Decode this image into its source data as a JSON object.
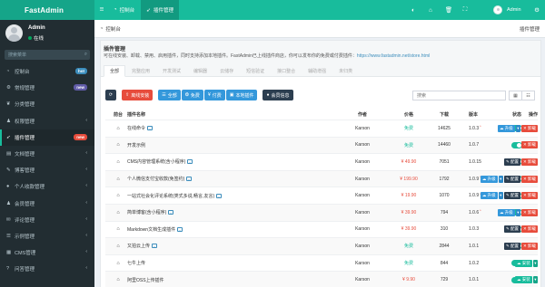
{
  "brand": "FastAdmin",
  "topnav": {
    "console": "控制台",
    "plugins": "插件管理"
  },
  "user": {
    "name": "Admin",
    "status": "在线"
  },
  "sidebar": {
    "search_placeholder": "搜索菜单",
    "items": [
      {
        "label": "控制台",
        "icon": "dashboard-icon",
        "badge": "hot",
        "badge_color": "#3c8dbc"
      },
      {
        "label": "常规管理",
        "icon": "cogs-icon",
        "badge": "new",
        "badge_color": "#605ca8"
      },
      {
        "label": "分类管理",
        "icon": "leaf-icon"
      },
      {
        "label": "权限管理",
        "icon": "group-icon"
      },
      {
        "label": "插件管理",
        "icon": "rocket-icon",
        "badge": "new",
        "badge_color": "#e74c3c",
        "active": true
      },
      {
        "label": "文档管理",
        "icon": "file-icon"
      },
      {
        "label": "博客管理",
        "icon": "blog-icon"
      },
      {
        "label": "个人收款管理",
        "icon": "user-icon"
      },
      {
        "label": "会员管理",
        "icon": "users-icon"
      },
      {
        "label": "评论管理",
        "icon": "comment-icon"
      },
      {
        "label": "示例管理",
        "icon": "list-icon"
      },
      {
        "label": "CMS管理",
        "icon": "cms-icon"
      },
      {
        "label": "问答管理",
        "icon": "question-icon"
      }
    ]
  },
  "breadcrumb": {
    "left": "控制台",
    "right": "插件管理"
  },
  "panel": {
    "title": "插件管理",
    "desc": "可在线安装、卸载、禁用、启用插件，同时支持添加本地插件。FastAdmin已上线插件商店，你可以发布你的免费或付费插件：",
    "link": "https://www.fastadmin.net/store.html"
  },
  "tabs": [
    "全部",
    "完整应用",
    "开发测试",
    "编辑器",
    "云储存",
    "短信验证",
    "接口整合",
    "辅助增强",
    "未归类"
  ],
  "toolbar": {
    "refresh": "",
    "offline_install": "离线安装",
    "all": "全部",
    "free": "免费",
    "paid": "付费",
    "local": "本地插件",
    "member": "会员信息",
    "search_placeholder": "搜索"
  },
  "table": {
    "headers": {
      "pre": "前台",
      "name": "插件名称",
      "author": "作者",
      "price": "价格",
      "downloads": "下载",
      "version": "版本",
      "status": "状态",
      "ops": "操作"
    },
    "rows": [
      {
        "name": "在线命令",
        "author": "Karson",
        "price": "免费",
        "downloads": "14625",
        "version": "1.0.3",
        "ops": [
          "upgrade",
          "uninstall"
        ]
      },
      {
        "name": "开发示例",
        "author": "Karson",
        "price": "免费",
        "downloads": "14460",
        "version": "1.0.7",
        "ops": [
          "uninstall"
        ]
      },
      {
        "name": "CMS内容管理系统(含小程序)",
        "author": "Karson",
        "price": "¥ 49.90",
        "downloads": "7051",
        "version": "1.0.15",
        "ops": [
          "config",
          "uninstall"
        ]
      },
      {
        "name": "个人微信支付宝收款(免签约)",
        "author": "Karson",
        "price": "¥ 199.90",
        "downloads": "1792",
        "version": "1.0.9",
        "ops": [
          "upgrade",
          "config",
          "uninstall"
        ]
      },
      {
        "name": "一站式社会化评论系统(类式多说,畅言,友言)",
        "author": "Karson",
        "price": "¥ 19.90",
        "downloads": "1070",
        "version": "1.0.9",
        "ops": [
          "upgrade",
          "config",
          "uninstall"
        ]
      },
      {
        "name": "简单博客(含小程序)",
        "author": "Karson",
        "price": "¥ 39.90",
        "downloads": "794",
        "version": "1.0.6",
        "ops": [
          "upgrade",
          "uninstall"
        ]
      },
      {
        "name": "Markdown文档生成插件",
        "author": "Karson",
        "price": "¥ 39.90",
        "downloads": "310",
        "version": "1.0.3",
        "ops": [
          "config",
          "uninstall"
        ]
      },
      {
        "name": "又拍云上传",
        "author": "Karson",
        "price": "免费",
        "downloads": "2844",
        "version": "1.0.1",
        "ops": [
          "config",
          "uninstall"
        ]
      },
      {
        "name": "七牛上传",
        "author": "Karson",
        "price": "免费",
        "downloads": "844",
        "version": "1.0.2",
        "ops": [
          "install"
        ]
      },
      {
        "name": "阿里OSS上传插件",
        "author": "Karson",
        "price": "¥ 9.90",
        "downloads": "729",
        "version": "1.0.1",
        "ops": [
          "install"
        ]
      }
    ],
    "op_labels": {
      "upgrade": "升级",
      "config": "配置",
      "uninstall": "卸载",
      "install": "安装"
    }
  },
  "colors": {
    "primary": "#18bc9c",
    "sidebar": "#222d32",
    "danger": "#e74c3c",
    "info": "#3498db"
  }
}
